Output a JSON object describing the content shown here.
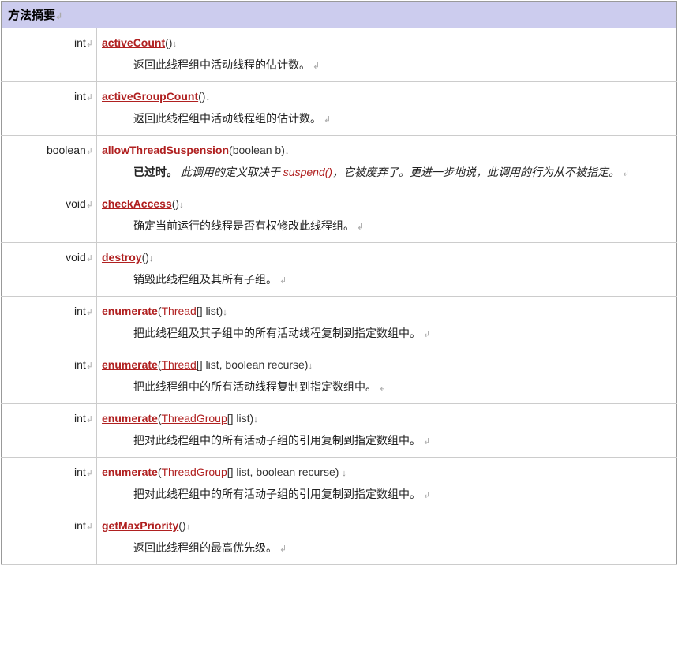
{
  "header": "方法摘要",
  "markers": {
    "return_suffix": "↲",
    "line_end": "↲",
    "down": "↓"
  },
  "rows": [
    {
      "return_type": "int",
      "method": "activeCount",
      "sig_parts": [
        {
          "t": "plain",
          "v": "()"
        }
      ],
      "desc_parts": [
        {
          "t": "plain",
          "v": "返回此线程组中活动线程的估计数。"
        }
      ]
    },
    {
      "return_type": "int",
      "method": "activeGroupCount",
      "sig_parts": [
        {
          "t": "plain",
          "v": "()"
        }
      ],
      "desc_parts": [
        {
          "t": "plain",
          "v": "返回此线程组中活动线程组的估计数。"
        }
      ]
    },
    {
      "return_type": "boolean",
      "method": "allowThreadSuspension",
      "sig_parts": [
        {
          "t": "plain",
          "v": "(boolean b)"
        }
      ],
      "desc_parts": [
        {
          "t": "dep_label",
          "v": "已过时。"
        },
        {
          "t": "dep_text",
          "v": " 此调用的定义取决于 "
        },
        {
          "t": "suspend",
          "v": "suspend()"
        },
        {
          "t": "dep_text",
          "v": "，它被废弃了。更进一步地说，此调用的行为从不被指定。"
        }
      ]
    },
    {
      "return_type": "void",
      "method": "checkAccess",
      "sig_parts": [
        {
          "t": "plain",
          "v": "()"
        }
      ],
      "desc_parts": [
        {
          "t": "plain",
          "v": "确定当前运行的线程是否有权修改此线程组。"
        }
      ]
    },
    {
      "return_type": "void",
      "method": "destroy",
      "sig_parts": [
        {
          "t": "plain",
          "v": "()"
        }
      ],
      "desc_parts": [
        {
          "t": "plain",
          "v": "销毁此线程组及其所有子组。"
        }
      ]
    },
    {
      "return_type": "int",
      "method": "enumerate",
      "sig_parts": [
        {
          "t": "plain",
          "v": "("
        },
        {
          "t": "type",
          "v": "Thread"
        },
        {
          "t": "plain",
          "v": "[] list)"
        }
      ],
      "desc_parts": [
        {
          "t": "plain",
          "v": "把此线程组及其子组中的所有活动线程复制到指定数组中。"
        }
      ]
    },
    {
      "return_type": "int",
      "method": "enumerate",
      "sig_parts": [
        {
          "t": "plain",
          "v": "("
        },
        {
          "t": "type",
          "v": "Thread"
        },
        {
          "t": "plain",
          "v": "[] list, boolean recurse)"
        }
      ],
      "desc_parts": [
        {
          "t": "plain",
          "v": "把此线程组中的所有活动线程复制到指定数组中。"
        }
      ]
    },
    {
      "return_type": "int",
      "method": "enumerate",
      "sig_parts": [
        {
          "t": "plain",
          "v": "("
        },
        {
          "t": "type",
          "v": "ThreadGroup"
        },
        {
          "t": "plain",
          "v": "[] list)"
        }
      ],
      "desc_parts": [
        {
          "t": "plain",
          "v": "把对此线程组中的所有活动子组的引用复制到指定数组中。"
        }
      ]
    },
    {
      "return_type": "int",
      "method": "enumerate",
      "sig_parts": [
        {
          "t": "plain",
          "v": "("
        },
        {
          "t": "type",
          "v": "ThreadGroup"
        },
        {
          "t": "plain",
          "v": "[] list, boolean recurse) "
        }
      ],
      "desc_parts": [
        {
          "t": "plain",
          "v": "把对此线程组中的所有活动子组的引用复制到指定数组中。"
        }
      ]
    },
    {
      "return_type": "int",
      "method": "getMaxPriority",
      "sig_parts": [
        {
          "t": "plain",
          "v": "()"
        }
      ],
      "desc_parts": [
        {
          "t": "plain",
          "v": "返回此线程组的最高优先级。"
        }
      ]
    }
  ]
}
